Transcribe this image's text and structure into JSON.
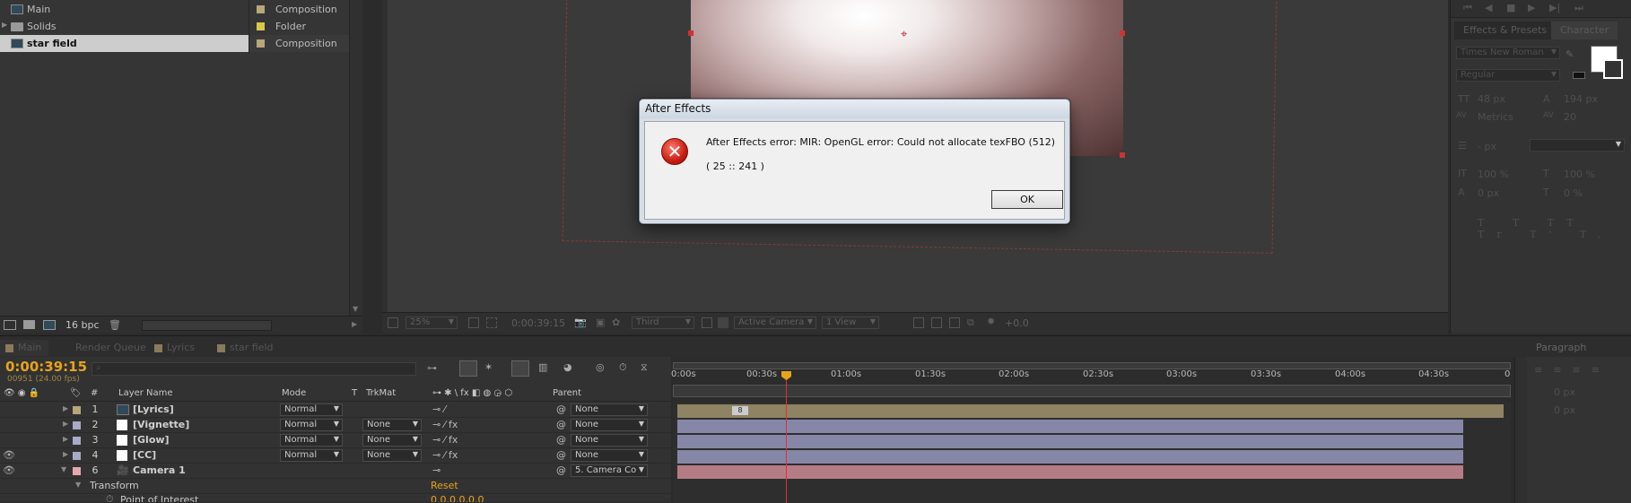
{
  "project": {
    "items": [
      {
        "name": "Main",
        "type": "Composition",
        "color": "#b7a77a"
      },
      {
        "name": "Solids",
        "type": "Folder",
        "color": "#d8c84a"
      },
      {
        "name": "star field",
        "type": "Composition",
        "color": "#b7a77a"
      }
    ],
    "bpc": "16 bpc"
  },
  "comp_viewer": {
    "zoom": "25%",
    "timecode": "0:00:39:15",
    "resolution": "Third",
    "camera": "Active Camera",
    "views": "1 View",
    "exposure": "+0.0"
  },
  "right_panel": {
    "tabs": [
      "Effects & Presets",
      "Character"
    ],
    "font": "Times New Roman",
    "style": "Regular",
    "size": "48 px",
    "leading": "194 px",
    "kerning": "Metrics",
    "tracking": "20",
    "unit": "- px",
    "vscale": "100 %",
    "hscale": "100 %",
    "baseline": "0 px",
    "tsume": "0 %",
    "paragraph_tab": "Paragraph",
    "para_values": [
      "0 px",
      "0 px"
    ]
  },
  "timeline": {
    "tabs": [
      "Main",
      "Render Queue",
      "Lyrics",
      "star field"
    ],
    "time": "0:00:39:15",
    "frame": "00951 (24.00 fps)",
    "columns": {
      "num": "#",
      "layer_name": "Layer Name",
      "mode": "Mode",
      "t": "T",
      "trkmat": "TrkMat",
      "parent": "Parent"
    },
    "ruler": [
      "0:00s",
      "00:30s",
      "01:00s",
      "01:30s",
      "02:00s",
      "02:30s",
      "03:00s",
      "03:30s",
      "04:00s",
      "04:30s",
      "0"
    ],
    "layers": [
      {
        "num": "1",
        "name": "[Lyrics]",
        "mode": "Normal",
        "trkmat": "",
        "parent": "None",
        "color": "#b7a77a"
      },
      {
        "num": "2",
        "name": "[Vignette]",
        "mode": "Normal",
        "trkmat": "None",
        "parent": "None",
        "color": "#a9a9c9"
      },
      {
        "num": "3",
        "name": "[Glow]",
        "mode": "Normal",
        "trkmat": "None",
        "parent": "None",
        "color": "#a9a9c9"
      },
      {
        "num": "4",
        "name": "[CC]",
        "mode": "Normal",
        "trkmat": "None",
        "parent": "None",
        "color": "#a9a9c9"
      },
      {
        "num": "6",
        "name": "Camera 1",
        "mode": "",
        "trkmat": "",
        "parent": "5. Camera Co",
        "color": "#e3a9b2"
      }
    ],
    "transform": "Transform",
    "reset": "Reset",
    "point_of_interest": "Point of Interest",
    "poi_value": "0.0,0.0,0.0",
    "lyrics_marker": "8"
  },
  "dialog": {
    "title": "After Effects",
    "message": "After Effects error: MIR: OpenGL error: Could not allocate texFBO  (512)",
    "code": "( 25 :: 241 )",
    "ok": "OK"
  }
}
